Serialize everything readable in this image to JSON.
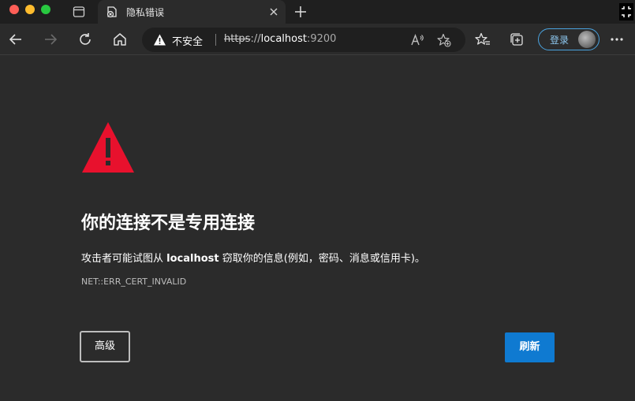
{
  "tab": {
    "title": "隐私错误"
  },
  "address_bar": {
    "security_label": "不安全",
    "url_scheme": "https",
    "url_separator": "://",
    "url_host": "localhost",
    "url_port": ":9200"
  },
  "toolbar": {
    "signin_label": "登录"
  },
  "page": {
    "heading": "你的连接不是专用连接",
    "desc_prefix": "攻击者可能试图从 ",
    "desc_host": "localhost",
    "desc_suffix": " 窃取你的信息(例如，密码、消息或信用卡)。",
    "error_code": "NET::ERR_CERT_INVALID",
    "advanced_button": "高级",
    "refresh_button": "刷新"
  },
  "colors": {
    "warning_red": "#e8112d",
    "primary_button": "#0f7ad1",
    "background": "#2b2b2b"
  }
}
